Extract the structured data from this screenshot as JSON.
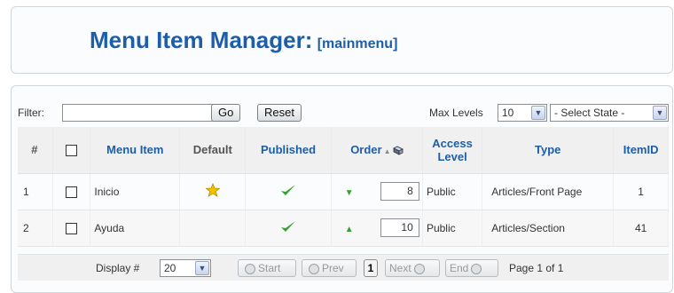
{
  "header": {
    "title": "Menu Item Manager:",
    "subtitle": "[mainmenu]"
  },
  "filter": {
    "label": "Filter:",
    "value": "",
    "go_label": "Go",
    "reset_label": "Reset",
    "levels_label": "Max Levels",
    "levels_value": "10",
    "state_value": "- Select State -"
  },
  "table": {
    "columns": [
      "#",
      "",
      "Menu Item",
      "Default",
      "Published",
      "Order",
      "Access Level",
      "Type",
      "ItemID"
    ],
    "rows": [
      {
        "num": "1",
        "name": "Inicio",
        "default": true,
        "published": true,
        "order_dir": "down",
        "order": "8",
        "access": "Public",
        "type": "Articles/Front Page",
        "itemid": "1"
      },
      {
        "num": "2",
        "name": "Ayuda",
        "default": false,
        "published": true,
        "order_dir": "up",
        "order": "10",
        "access": "Public",
        "type": "Articles/Section",
        "itemid": "41"
      }
    ]
  },
  "footer": {
    "display_label": "Display #",
    "display_value": "20",
    "start": "Start",
    "prev": "Prev",
    "current_page": "1",
    "next": "Next",
    "end": "End",
    "page_info": "Page 1 of 1"
  },
  "icons": {
    "default": "star-icon",
    "published": "checkmark-icon",
    "order_save": "save-icon"
  },
  "colors": {
    "link": "#1d5ea8",
    "access": "#1a8a1a",
    "check": "#2ea32e",
    "star": "#f2c200"
  }
}
